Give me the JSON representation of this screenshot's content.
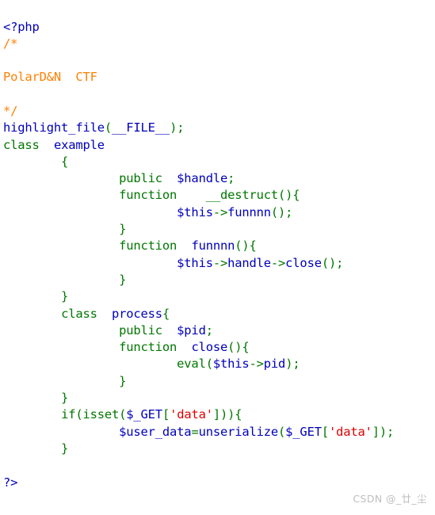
{
  "document": {
    "kind": "php-source-highlight",
    "background_color": "#ffffff"
  },
  "palette": {
    "default": "#0000BB",
    "keyword": "#007700",
    "comment": "#FF8000",
    "string": "#DD0000",
    "html": "#000000",
    "watermark": "#bfbfbf"
  },
  "code": {
    "language": "PHP",
    "lines": [
      {
        "n": 1,
        "tokens": [
          {
            "t": "<?php",
            "c": "default"
          }
        ]
      },
      {
        "n": 2,
        "tokens": [
          {
            "t": "/*",
            "c": "comment"
          }
        ]
      },
      {
        "n": 3,
        "tokens": [
          {
            "t": "",
            "c": "comment"
          }
        ]
      },
      {
        "n": 4,
        "tokens": [
          {
            "t": "PolarD&N  CTF",
            "c": "comment"
          }
        ]
      },
      {
        "n": 5,
        "tokens": [
          {
            "t": "",
            "c": "comment"
          }
        ]
      },
      {
        "n": 6,
        "tokens": [
          {
            "t": "*/",
            "c": "comment"
          }
        ]
      },
      {
        "n": 7,
        "tokens": [
          {
            "t": "highlight_file",
            "c": "default"
          },
          {
            "t": "(",
            "c": "keyword"
          },
          {
            "t": "__FILE__",
            "c": "default"
          },
          {
            "t": ");",
            "c": "keyword"
          }
        ]
      },
      {
        "n": 8,
        "tokens": [
          {
            "t": "class",
            "c": "keyword"
          },
          {
            "t": "  ",
            "c": "keyword"
          },
          {
            "t": "example",
            "c": "default"
          }
        ]
      },
      {
        "n": 9,
        "tokens": [
          {
            "t": "        {",
            "c": "keyword"
          }
        ]
      },
      {
        "n": 10,
        "tokens": [
          {
            "t": "                ",
            "c": "keyword"
          },
          {
            "t": "public",
            "c": "keyword"
          },
          {
            "t": "  ",
            "c": "keyword"
          },
          {
            "t": "$handle",
            "c": "default"
          },
          {
            "t": ";",
            "c": "keyword"
          }
        ]
      },
      {
        "n": 11,
        "tokens": [
          {
            "t": "                ",
            "c": "keyword"
          },
          {
            "t": "function",
            "c": "keyword"
          },
          {
            "t": "    ",
            "c": "keyword"
          },
          {
            "t": "__destruct",
            "c": "keyword"
          },
          {
            "t": "(){",
            "c": "keyword"
          }
        ]
      },
      {
        "n": 12,
        "tokens": [
          {
            "t": "                        ",
            "c": "keyword"
          },
          {
            "t": "$this",
            "c": "default"
          },
          {
            "t": "->",
            "c": "keyword"
          },
          {
            "t": "funnnn",
            "c": "default"
          },
          {
            "t": "();",
            "c": "keyword"
          }
        ]
      },
      {
        "n": 13,
        "tokens": [
          {
            "t": "                }",
            "c": "keyword"
          }
        ]
      },
      {
        "n": 14,
        "tokens": [
          {
            "t": "                ",
            "c": "keyword"
          },
          {
            "t": "function",
            "c": "keyword"
          },
          {
            "t": "  ",
            "c": "keyword"
          },
          {
            "t": "funnnn",
            "c": "default"
          },
          {
            "t": "(){",
            "c": "keyword"
          }
        ]
      },
      {
        "n": 15,
        "tokens": [
          {
            "t": "                        ",
            "c": "keyword"
          },
          {
            "t": "$this",
            "c": "default"
          },
          {
            "t": "->",
            "c": "keyword"
          },
          {
            "t": "handle",
            "c": "default"
          },
          {
            "t": "->",
            "c": "keyword"
          },
          {
            "t": "close",
            "c": "default"
          },
          {
            "t": "();",
            "c": "keyword"
          }
        ]
      },
      {
        "n": 16,
        "tokens": [
          {
            "t": "                }",
            "c": "keyword"
          }
        ]
      },
      {
        "n": 17,
        "tokens": [
          {
            "t": "        }",
            "c": "keyword"
          }
        ]
      },
      {
        "n": 18,
        "tokens": [
          {
            "t": "        ",
            "c": "keyword"
          },
          {
            "t": "class",
            "c": "keyword"
          },
          {
            "t": "  ",
            "c": "keyword"
          },
          {
            "t": "process",
            "c": "default"
          },
          {
            "t": "{",
            "c": "keyword"
          }
        ]
      },
      {
        "n": 19,
        "tokens": [
          {
            "t": "                ",
            "c": "keyword"
          },
          {
            "t": "public",
            "c": "keyword"
          },
          {
            "t": "  ",
            "c": "keyword"
          },
          {
            "t": "$pid",
            "c": "default"
          },
          {
            "t": ";",
            "c": "keyword"
          }
        ]
      },
      {
        "n": 20,
        "tokens": [
          {
            "t": "                ",
            "c": "keyword"
          },
          {
            "t": "function",
            "c": "keyword"
          },
          {
            "t": "  ",
            "c": "keyword"
          },
          {
            "t": "close",
            "c": "default"
          },
          {
            "t": "(){",
            "c": "keyword"
          }
        ]
      },
      {
        "n": 21,
        "tokens": [
          {
            "t": "                        ",
            "c": "keyword"
          },
          {
            "t": "eval",
            "c": "keyword"
          },
          {
            "t": "(",
            "c": "keyword"
          },
          {
            "t": "$this",
            "c": "default"
          },
          {
            "t": "->",
            "c": "keyword"
          },
          {
            "t": "pid",
            "c": "default"
          },
          {
            "t": ");",
            "c": "keyword"
          }
        ]
      },
      {
        "n": 22,
        "tokens": [
          {
            "t": "                }",
            "c": "keyword"
          }
        ]
      },
      {
        "n": 23,
        "tokens": [
          {
            "t": "        }",
            "c": "keyword"
          }
        ]
      },
      {
        "n": 24,
        "tokens": [
          {
            "t": "        ",
            "c": "keyword"
          },
          {
            "t": "if",
            "c": "keyword"
          },
          {
            "t": "(",
            "c": "keyword"
          },
          {
            "t": "isset",
            "c": "keyword"
          },
          {
            "t": "(",
            "c": "keyword"
          },
          {
            "t": "$_GET",
            "c": "default"
          },
          {
            "t": "[",
            "c": "keyword"
          },
          {
            "t": "'data'",
            "c": "string"
          },
          {
            "t": "])){",
            "c": "keyword"
          }
        ]
      },
      {
        "n": 25,
        "tokens": [
          {
            "t": "                ",
            "c": "keyword"
          },
          {
            "t": "$user_data",
            "c": "default"
          },
          {
            "t": "=",
            "c": "keyword"
          },
          {
            "t": "unserialize",
            "c": "default"
          },
          {
            "t": "(",
            "c": "keyword"
          },
          {
            "t": "$_GET",
            "c": "default"
          },
          {
            "t": "[",
            "c": "keyword"
          },
          {
            "t": "'data'",
            "c": "string"
          },
          {
            "t": "]);",
            "c": "keyword"
          }
        ]
      },
      {
        "n": 26,
        "tokens": [
          {
            "t": "        }",
            "c": "keyword"
          }
        ]
      },
      {
        "n": 27,
        "tokens": [
          {
            "t": "",
            "c": "keyword"
          }
        ]
      },
      {
        "n": 28,
        "tokens": [
          {
            "t": "?>",
            "c": "default"
          }
        ]
      }
    ]
  },
  "watermark": {
    "text": "CSDN @_廿_尘"
  }
}
